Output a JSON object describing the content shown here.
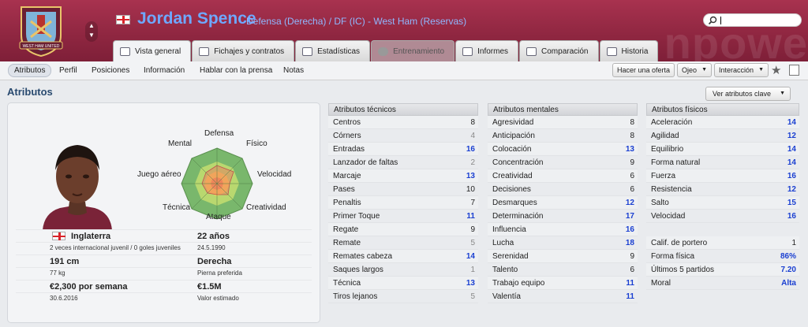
{
  "header": {
    "name": "Jordan Spence",
    "position": "Defensa (Derecha) / DF (IC) - West Ham (Reservas)",
    "crest_text": "WEST HAM UNITED",
    "watermark": "npowe",
    "search_placeholder": ""
  },
  "tabs": [
    {
      "label": "Vista general"
    },
    {
      "label": "Fichajes y contratos"
    },
    {
      "label": "Estadísticas"
    },
    {
      "label": "Entrenamiento"
    },
    {
      "label": "Informes"
    },
    {
      "label": "Comparación"
    },
    {
      "label": "Historia"
    }
  ],
  "subnav": [
    "Atributos",
    "Perfil",
    "Posiciones",
    "Información",
    "Hablar con la prensa",
    "Notas"
  ],
  "buttons": {
    "offer": "Hacer una oferta",
    "scout": "Ojeo",
    "interaction": "Interacción"
  },
  "section_title": "Atributos",
  "key_attrs_btn": "Ver atributos clave",
  "radar_labels": {
    "top": "Defensa",
    "tr": "Físico",
    "r": "Velocidad",
    "br": "Creatividad",
    "bottom": "Ataque",
    "bl": "Técnica",
    "l": "Juego aéreo",
    "tl": "Mental"
  },
  "bio": {
    "nation": "Inglaterra",
    "age": "22 años",
    "caps": "2 veces internacional juvenil / 0 goles juveniles",
    "dob": "24.5.1990",
    "height": "191 cm",
    "foot": "Derecha",
    "weight": "77 kg",
    "foot_label": "Pierna preferida",
    "wage": "€2,300 por semana",
    "value": "€1.5M",
    "contract": "30.6.2016",
    "value_label": "Valor estimado"
  },
  "technical": {
    "title": "Atributos técnicos",
    "rows": [
      [
        "Centros",
        "8"
      ],
      [
        "Córners",
        "4"
      ],
      [
        "Entradas",
        "16"
      ],
      [
        "Lanzador de faltas",
        "2"
      ],
      [
        "Marcaje",
        "13"
      ],
      [
        "Pases",
        "10"
      ],
      [
        "Penaltis",
        "7"
      ],
      [
        "Primer Toque",
        "11"
      ],
      [
        "Regate",
        "9"
      ],
      [
        "Remate",
        "5"
      ],
      [
        "Remates cabeza",
        "14"
      ],
      [
        "Saques largos",
        "1"
      ],
      [
        "Técnica",
        "13"
      ],
      [
        "Tiros lejanos",
        "5"
      ]
    ]
  },
  "mental": {
    "title": "Atributos mentales",
    "rows": [
      [
        "Agresividad",
        "8"
      ],
      [
        "Anticipación",
        "8"
      ],
      [
        "Colocación",
        "13"
      ],
      [
        "Concentración",
        "9"
      ],
      [
        "Creatividad",
        "6"
      ],
      [
        "Decisiones",
        "6"
      ],
      [
        "Desmarques",
        "12"
      ],
      [
        "Determinación",
        "17"
      ],
      [
        "Influencia",
        "16"
      ],
      [
        "Lucha",
        "18"
      ],
      [
        "Serenidad",
        "9"
      ],
      [
        "Talento",
        "6"
      ],
      [
        "Trabajo equipo",
        "11"
      ],
      [
        "Valentía",
        "11"
      ]
    ]
  },
  "physical": {
    "title": "Atributos físicos",
    "rows": [
      [
        "Aceleración",
        "14"
      ],
      [
        "Agilidad",
        "12"
      ],
      [
        "Equilibrio",
        "14"
      ],
      [
        "Forma natural",
        "14"
      ],
      [
        "Fuerza",
        "16"
      ],
      [
        "Resistencia",
        "12"
      ],
      [
        "Salto",
        "15"
      ],
      [
        "Velocidad",
        "16"
      ]
    ]
  },
  "extra": {
    "rows": [
      [
        "Calif. de portero",
        "1"
      ],
      [
        "Forma física",
        "86%"
      ],
      [
        "Últimos 5 partidos",
        "7.20"
      ],
      [
        "Moral",
        "Alta"
      ]
    ]
  }
}
